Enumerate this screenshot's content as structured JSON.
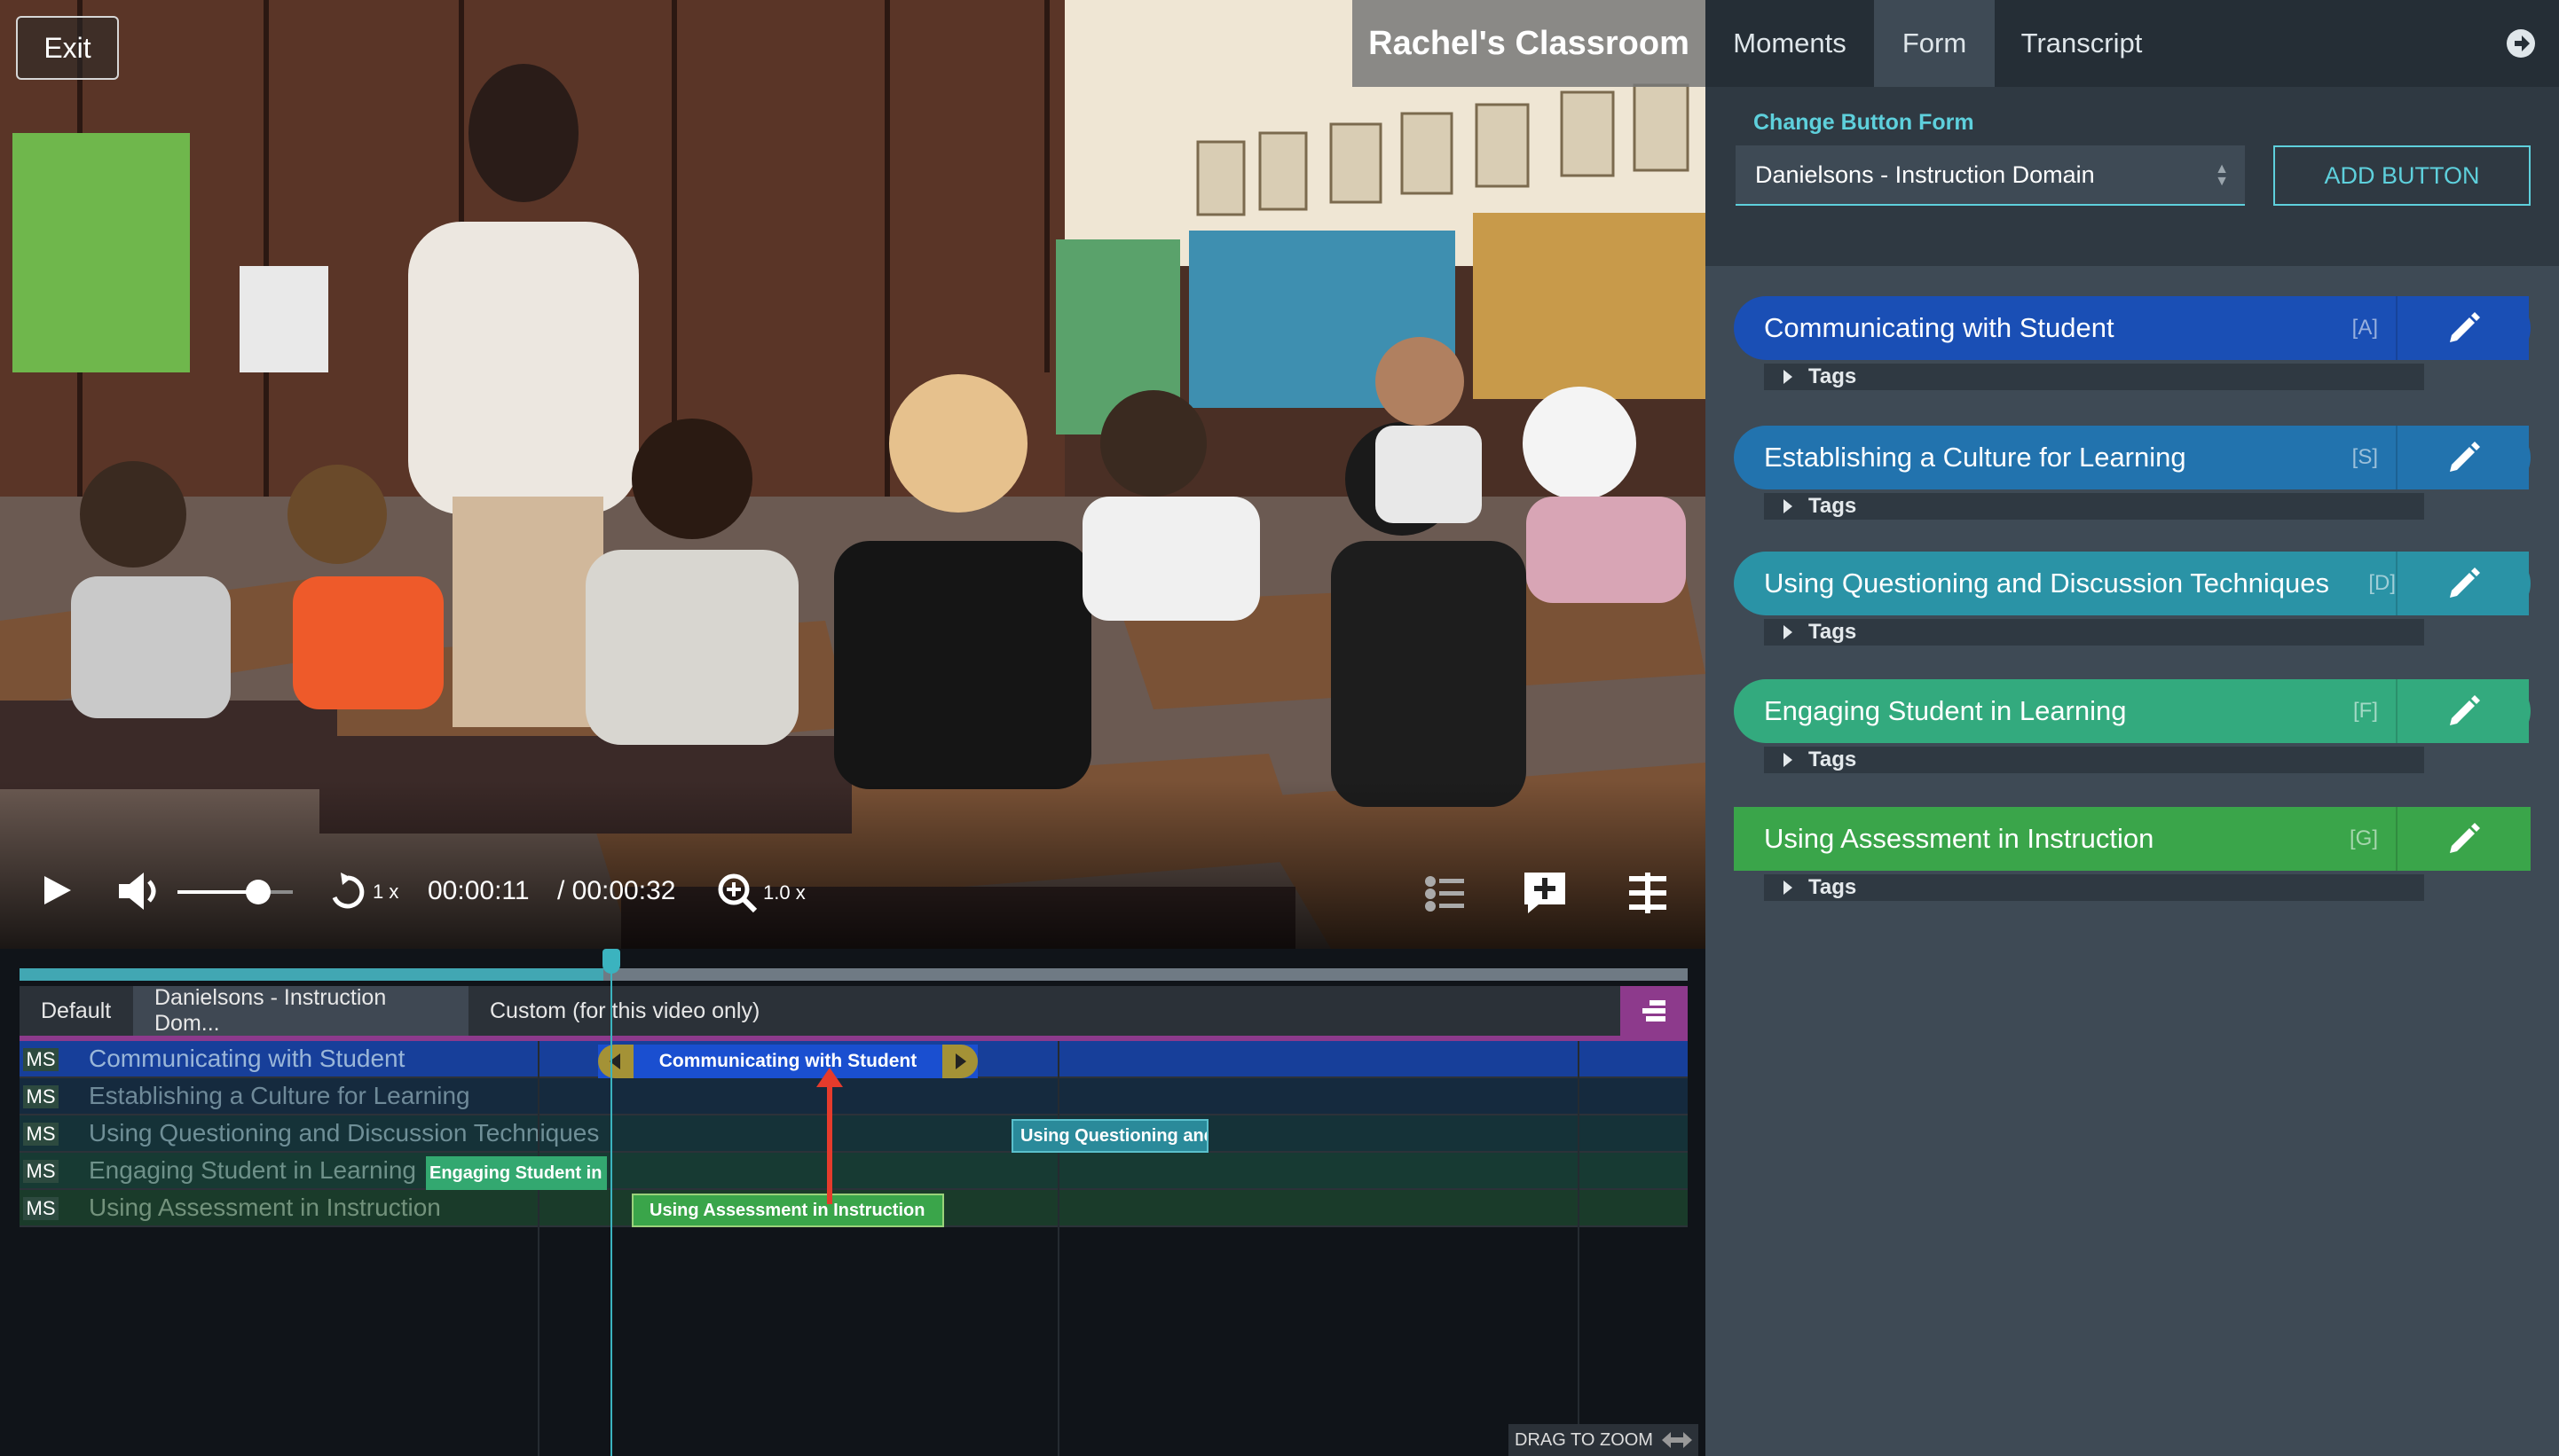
{
  "video": {
    "exit_label": "Exit",
    "title": "Rachel's Classroom",
    "current_time": "00:00:11",
    "duration": "/ 00:00:32",
    "speed": "1 x",
    "zoom": "1.0 x",
    "volume_level": 0.7,
    "progress": 0.35
  },
  "timeline": {
    "tabs": [
      {
        "label": "Default"
      },
      {
        "label": "Danielsons - Instruction Dom..."
      },
      {
        "label": "Custom (for this video only)"
      }
    ],
    "row_badge": "MS",
    "rows": [
      {
        "label": "Communicating with Student",
        "color": "#173f9a"
      },
      {
        "label": "Establishing a Culture for Learning",
        "color": "#152a3e"
      },
      {
        "label": "Using Questioning and Discussion Techniques",
        "color": "#153238"
      },
      {
        "label": "Engaging Student in Learning",
        "color": "#173a33"
      },
      {
        "label": "Using Assessment in Instruction",
        "color": "#1a3b2a"
      }
    ],
    "segments": [
      {
        "label": "Communicating with Student"
      },
      {
        "label": "Using Questioning and"
      },
      {
        "label": "Engaging Student in"
      },
      {
        "label": "Using Assessment in Instruction"
      }
    ],
    "zoom_hint": "DRAG TO ZOOM"
  },
  "panel": {
    "tabs": [
      {
        "label": "Moments"
      },
      {
        "label": "Form"
      },
      {
        "label": "Transcript"
      }
    ],
    "change_label": "Change Button Form",
    "selected_form": "Danielsons - Instruction Domain",
    "add_button_label": "ADD BUTTON",
    "tags_label": "Tags",
    "buttons": [
      {
        "label": "Communicating with Student",
        "key": "[A]",
        "color": "#1a4fb5"
      },
      {
        "label": "Establishing a Culture for Learning",
        "key": "[S]",
        "color": "#2273ae"
      },
      {
        "label": "Using Questioning and Discussion Techniques",
        "key": "[D]",
        "color": "#2a93a6"
      },
      {
        "label": "Engaging Student in Learning",
        "key": "[F]",
        "color": "#33aa7e"
      },
      {
        "label": "Using Assessment in Instruction",
        "key": "[G]",
        "color": "#3aa54a"
      }
    ]
  }
}
